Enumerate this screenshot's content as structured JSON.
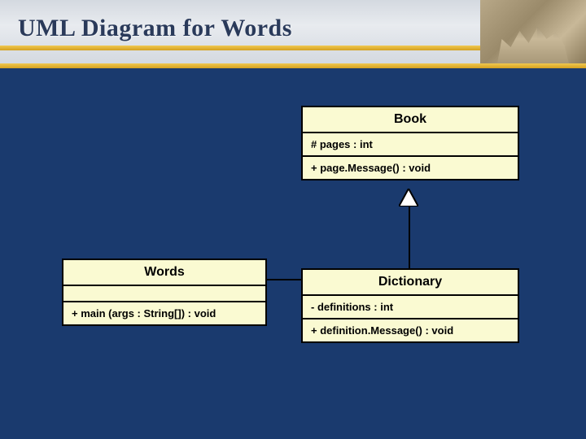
{
  "title": "UML Diagram for Words",
  "classes": {
    "book": {
      "name": "Book",
      "attr": "# pages : int",
      "op": "+ page.Message() : void"
    },
    "words": {
      "name": "Words",
      "op": "+ main (args : String[]) : void"
    },
    "dictionary": {
      "name": "Dictionary",
      "attr": "- definitions : int",
      "op": "+ definition.Message() : void"
    }
  }
}
